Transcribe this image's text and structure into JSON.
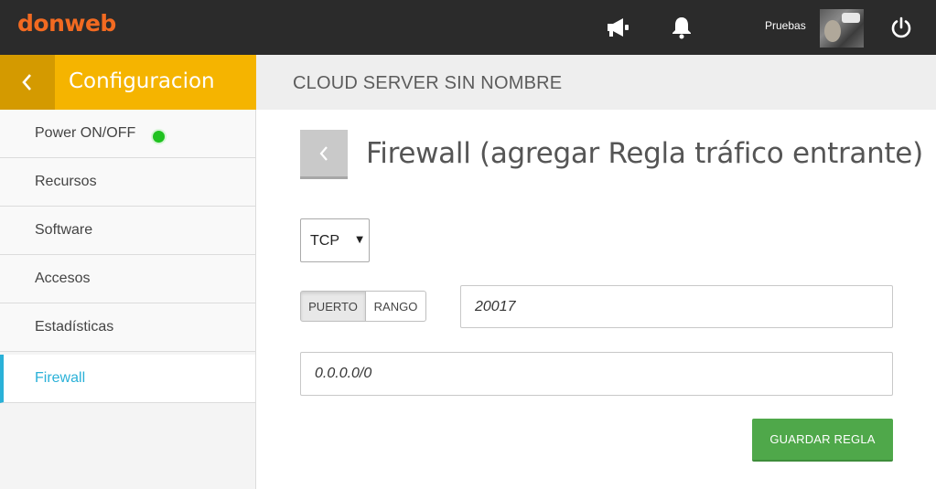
{
  "topbar": {
    "logo": "donweb",
    "icons": [
      "megaphone-icon",
      "bell-icon",
      "power-icon"
    ],
    "user_name": "Pruebas"
  },
  "sidebar": {
    "title": "Configuracion",
    "items": [
      {
        "label": "Power ON/OFF",
        "status": "on"
      },
      {
        "label": "Recursos"
      },
      {
        "label": "Software"
      },
      {
        "label": "Accesos"
      },
      {
        "label": "Estadísticas"
      },
      {
        "label": "Firewall",
        "active": true
      }
    ]
  },
  "content": {
    "server_name": "CLOUD SERVER SIN NOMBRE",
    "page_title": "Firewall (agregar Regla tráfico entrante)",
    "protocol": {
      "selected": "TCP"
    },
    "port_mode": {
      "options": [
        "PUERTO",
        "RANGO"
      ],
      "selected": "PUERTO"
    },
    "port_value": "20017",
    "ip_value": "0.0.0.0/0",
    "save_label": "GUARDAR REGLA"
  },
  "colors": {
    "topbar": "#2b2b2b",
    "brand_orange": "#f26a21",
    "sidebar_header": "#f5b400",
    "active_accent": "#2ab1d8",
    "status_on": "#1fc21f",
    "save_button": "#4fa84a"
  }
}
